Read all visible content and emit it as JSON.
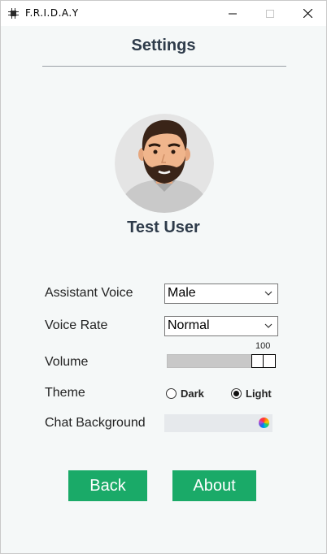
{
  "window": {
    "title": "F.R.I.D.A.Y"
  },
  "page": {
    "title": "Settings"
  },
  "user": {
    "name": "Test User"
  },
  "settings": {
    "voice": {
      "label": "Assistant Voice",
      "value": "Male"
    },
    "rate": {
      "label": "Voice Rate",
      "value": "Normal"
    },
    "volume": {
      "label": "Volume",
      "value": "100",
      "level": 1.0
    },
    "theme": {
      "label": "Theme",
      "options": [
        {
          "label": "Dark",
          "checked": false
        },
        {
          "label": "Light",
          "checked": true
        }
      ]
    },
    "chat_background": {
      "label": "Chat Background"
    }
  },
  "buttons": {
    "back": "Back",
    "about": "About"
  },
  "colors": {
    "accent": "#1aaa68",
    "heading": "#2e3b4a",
    "background": "#f5f8f8"
  }
}
